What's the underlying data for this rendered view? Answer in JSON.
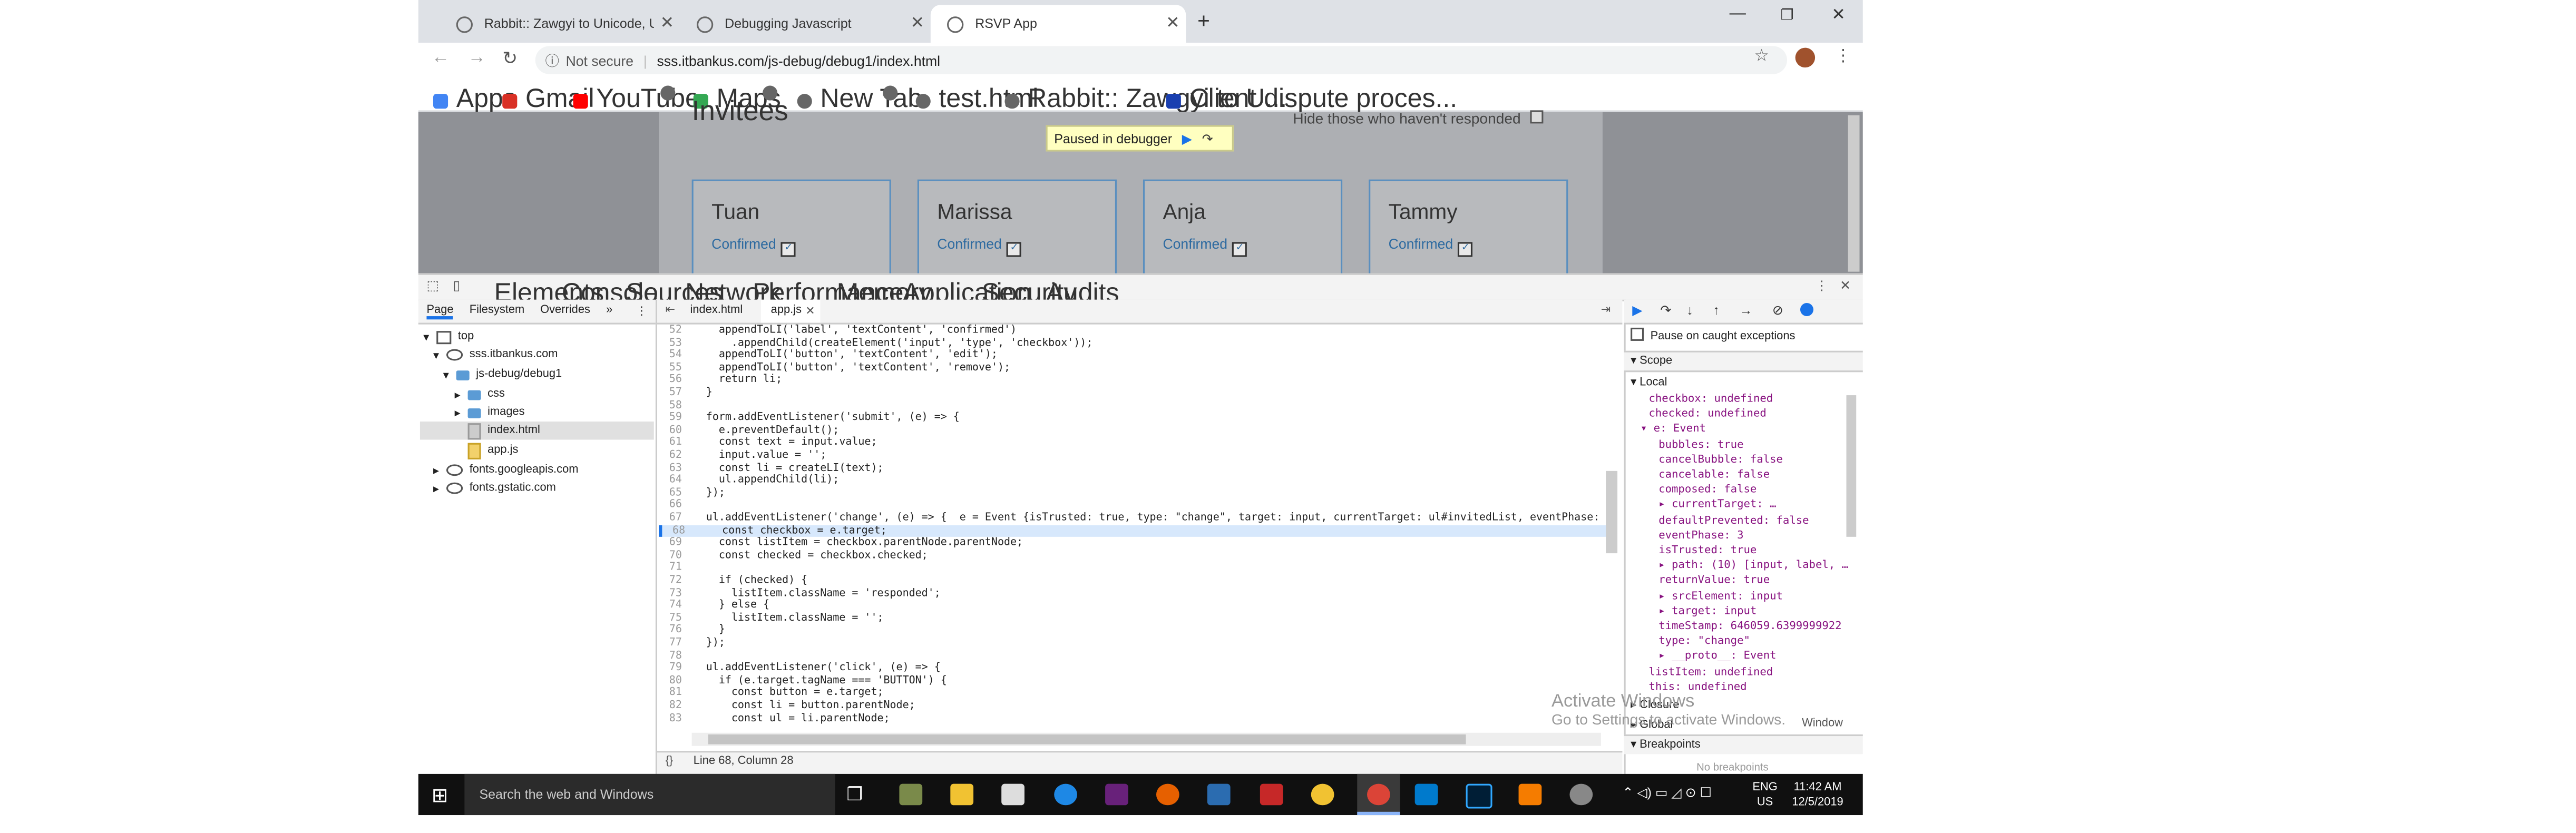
{
  "browser": {
    "tabs": [
      {
        "title": "Rabbit:: Zawgyi to Unicode, Unicod"
      },
      {
        "title": "Debugging Javascript"
      },
      {
        "title": "RSVP App"
      }
    ],
    "new_tab": "+",
    "window_controls": {
      "minimize": "—",
      "maximize": "❐",
      "close": "✕"
    },
    "security_label": "Not secure",
    "url": "sss.itbankus.com/js-debug/debug1/index.html",
    "bookmarks": [
      "Apps",
      "Gmail",
      "YouTube",
      "Maps",
      "New Tab",
      "test.html",
      "Rabbit:: Zawgyi to U...",
      "Client dispute proces..."
    ]
  },
  "page": {
    "heading": "Invitees",
    "hide_label": "Hide those who haven't responded",
    "paused_label": "Paused in debugger",
    "invitees": [
      {
        "name": "Tuan",
        "status": "Confirmed"
      },
      {
        "name": "Marissa",
        "status": "Confirmed"
      },
      {
        "name": "Anja",
        "status": "Confirmed"
      },
      {
        "name": "Tammy",
        "status": "Confirmed"
      }
    ]
  },
  "devtools": {
    "tabs": [
      "Elements",
      "Console",
      "Sources",
      "Network",
      "Performance",
      "Memory",
      "Application",
      "Security",
      "Audits"
    ],
    "active_tab": "Sources",
    "navigator_tabs": [
      "Page",
      "Filesystem",
      "Overrides",
      "»"
    ],
    "tree": [
      {
        "label": "top"
      },
      {
        "label": "sss.itbankus.com"
      },
      {
        "label": "js-debug/debug1"
      },
      {
        "label": "css"
      },
      {
        "label": "images"
      },
      {
        "label": "index.html"
      },
      {
        "label": "app.js"
      },
      {
        "label": "fonts.googleapis.com"
      },
      {
        "label": "fonts.gstatic.com"
      }
    ],
    "editor_tabs": [
      "index.html",
      "app.js"
    ],
    "code_lines": [
      {
        "n": "52",
        "t": "    appendToLI('label', 'textContent', 'confirmed')"
      },
      {
        "n": "53",
        "t": "      .appendChild(createElement('input', 'type', 'checkbox'));"
      },
      {
        "n": "54",
        "t": "    appendToLI('button', 'textContent', 'edit');"
      },
      {
        "n": "55",
        "t": "    appendToLI('button', 'textContent', 'remove');"
      },
      {
        "n": "56",
        "t": "    return li;"
      },
      {
        "n": "57",
        "t": "  }"
      },
      {
        "n": "58",
        "t": ""
      },
      {
        "n": "59",
        "t": "  form.addEventListener('submit', (e) => {"
      },
      {
        "n": "60",
        "t": "    e.preventDefault();"
      },
      {
        "n": "61",
        "t": "    const text = input.value;"
      },
      {
        "n": "62",
        "t": "    input.value = '';"
      },
      {
        "n": "63",
        "t": "    const li = createLI(text);"
      },
      {
        "n": "64",
        "t": "    ul.appendChild(li);"
      },
      {
        "n": "65",
        "t": "  });"
      },
      {
        "n": "66",
        "t": ""
      },
      {
        "n": "67",
        "t": "  ul.addEventListener('change', (e) => {  e = Event {isTrusted: true, type: \"change\", target: input, currentTarget: ul#invitedList, eventPhase:"
      },
      {
        "n": "68",
        "t": "    const checkbox = e.target;"
      },
      {
        "n": "69",
        "t": "    const listItem = checkbox.parentNode.parentNode;"
      },
      {
        "n": "70",
        "t": "    const checked = checkbox.checked;"
      },
      {
        "n": "71",
        "t": ""
      },
      {
        "n": "72",
        "t": "    if (checked) {"
      },
      {
        "n": "73",
        "t": "      listItem.className = 'responded';"
      },
      {
        "n": "74",
        "t": "    } else {"
      },
      {
        "n": "75",
        "t": "      listItem.className = '';"
      },
      {
        "n": "76",
        "t": "    }"
      },
      {
        "n": "77",
        "t": "  });"
      },
      {
        "n": "78",
        "t": ""
      },
      {
        "n": "79",
        "t": "  ul.addEventListener('click', (e) => {"
      },
      {
        "n": "80",
        "t": "    if (e.target.tagName === 'BUTTON') {"
      },
      {
        "n": "81",
        "t": "      const button = e.target;"
      },
      {
        "n": "82",
        "t": "      const li = button.parentNode;"
      },
      {
        "n": "83",
        "t": "      const ul = li.parentNode;"
      }
    ],
    "status": "Line 68, Column 28",
    "pause_on_caught": "Pause on caught exceptions",
    "scope_title": "Scope",
    "local_title": "Local",
    "scope_rows": [
      {
        "t": "checkbox: undefined"
      },
      {
        "t": "checked: undefined"
      },
      {
        "t": "▾ e: Event"
      },
      {
        "t": "bubbles: true"
      },
      {
        "t": "cancelBubble: false"
      },
      {
        "t": "cancelable: false"
      },
      {
        "t": "composed: false"
      },
      {
        "t": "▸ currentTarget: …"
      },
      {
        "t": "defaultPrevented: false"
      },
      {
        "t": "eventPhase: 3"
      },
      {
        "t": "isTrusted: true"
      },
      {
        "t": "▸ path: (10) [input, label, …"
      },
      {
        "t": "returnValue: true"
      },
      {
        "t": "▸ srcElement: input"
      },
      {
        "t": "▸ target: input"
      },
      {
        "t": "timeStamp: 646059.6399999922"
      },
      {
        "t": "type: \"change\""
      },
      {
        "t": "▸ __proto__: Event"
      },
      {
        "t": "listItem: undefined"
      },
      {
        "t": "this: undefined"
      }
    ],
    "closure": "Closure",
    "global": "Global",
    "window": "Window",
    "breakpoints": "Breakpoints",
    "no_breakpoints": "No breakpoints"
  },
  "watermark": {
    "line1": "Activate Windows",
    "line2": "Go to Settings to activate Windows."
  },
  "taskbar": {
    "search_placeholder": "Search the web and Windows",
    "lang": "ENG",
    "region": "US",
    "time": "11:42 AM",
    "date": "12/5/2019"
  }
}
